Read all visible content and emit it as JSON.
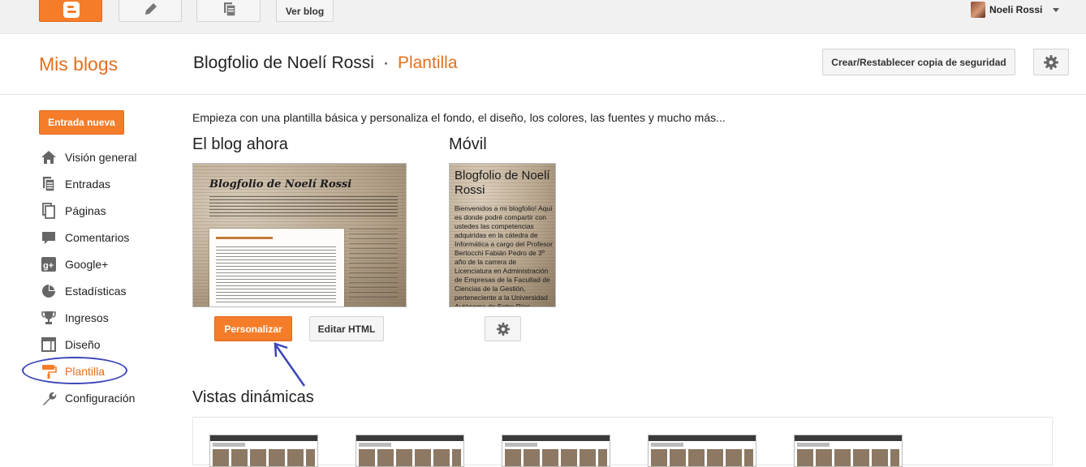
{
  "topbar": {
    "view_blog_label": "Ver blog",
    "user_name": "Noeli Rossi"
  },
  "header": {
    "my_blogs": "Mis blogs",
    "blog_name": "Blogfolio de Noelí Rossi",
    "separator": "·",
    "section": "Plantilla",
    "backup_button": "Crear/Restablecer copia de seguridad"
  },
  "sidebar": {
    "new_post_button": "Entrada nueva",
    "items": [
      {
        "label": "Visión general",
        "icon": "home-icon"
      },
      {
        "label": "Entradas",
        "icon": "posts-icon"
      },
      {
        "label": "Páginas",
        "icon": "pages-icon"
      },
      {
        "label": "Comentarios",
        "icon": "comments-icon"
      },
      {
        "label": "Google+",
        "icon": "google-plus-icon"
      },
      {
        "label": "Estadísticas",
        "icon": "stats-icon"
      },
      {
        "label": "Ingresos",
        "icon": "trophy-icon"
      },
      {
        "label": "Diseño",
        "icon": "layout-icon"
      },
      {
        "label": "Plantilla",
        "icon": "paint-roller-icon",
        "active": true
      },
      {
        "label": "Configuración",
        "icon": "wrench-icon"
      }
    ]
  },
  "main": {
    "intro": "Empieza con una plantilla básica y personaliza el fondo, el diseño, los colores, las fuentes y mucho más...",
    "current_heading": "El blog ahora",
    "mobile_heading": "Móvil",
    "desktop_preview_title": "Blogfolio de Noelí Rossi",
    "mobile_preview_title": "Blogfolio de Noelí Rossi",
    "mobile_preview_text": "Bienvenidos a mi blogfolio! Aquí es donde podré compartir con ustedes las competencias adquiridas en la cátedra de Informática a cargo del Profesor Bertocchi Fabián Pedro de 3º año de la carrera de Licenciatura en Administración de Empresas de la Facultad de Ciencias de la Gestión, perteneciente a la Universidad Autónoma de Entre Ríos",
    "customize_button": "Personalizar",
    "edit_html_button": "Editar HTML",
    "dynamic_views_heading": "Vistas dinámicas"
  },
  "colors": {
    "accent": "#e2701f",
    "button_orange": "#f57d2a",
    "annotation": "#3b45b8"
  }
}
